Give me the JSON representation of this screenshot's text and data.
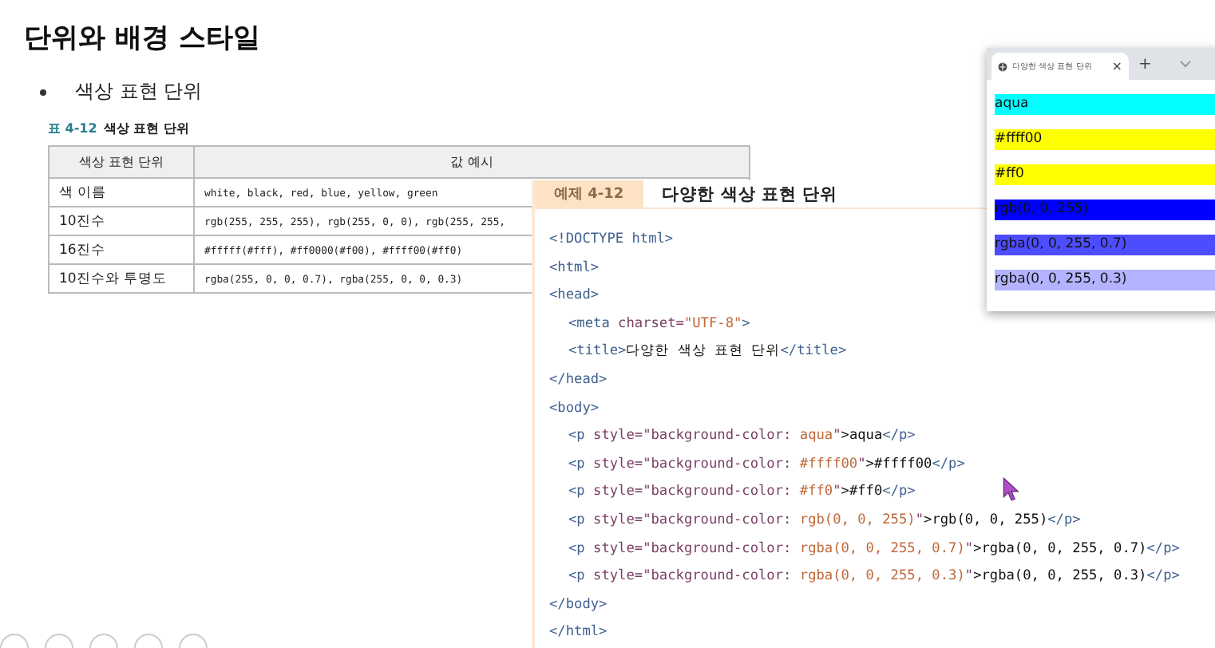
{
  "title": "단위와 배경 스타일",
  "bullet": "색상 표현 단위",
  "table": {
    "caption_label": "표 4-12",
    "caption_title": "색상 표현 단위",
    "columns": [
      "색상 표현 단위",
      "값 예시"
    ],
    "rows": [
      [
        "색 이름",
        "white, black, red, blue, yellow, green"
      ],
      [
        "10진수",
        "rgb(255, 255, 255), rgb(255, 0, 0), rgb(255, 255,"
      ],
      [
        "16진수",
        "#fffff(#fff), #ff0000(#f00), #ffff00(#ff0)"
      ],
      [
        "10진수와 투명도",
        "rgba(255, 0, 0, 0.7), rgba(255, 0, 0, 0.3)"
      ]
    ]
  },
  "example": {
    "tab": "예제 4-12",
    "title": "다양한 색상 표현 단위",
    "lines": [
      {
        "tokens": [
          {
            "kind": "tag",
            "text": "<!DOCTYPE html>"
          }
        ]
      },
      {
        "tokens": [
          {
            "kind": "tag",
            "text": "<html>"
          }
        ]
      },
      {
        "tokens": [
          {
            "kind": "tag",
            "text": "<head>"
          }
        ],
        "children": [
          {
            "tokens": [
              {
                "kind": "tag",
                "text": "<meta"
              },
              {
                "kind": "attr",
                "text": " charset="
              },
              {
                "kind": "value",
                "text": "\"UTF-8\""
              },
              {
                "kind": "tag",
                "text": ">"
              }
            ]
          },
          {
            "tokens": [
              {
                "kind": "tag",
                "text": "<title>"
              },
              {
                "kind": "text",
                "text": "다양한 색상 표현 단위"
              },
              {
                "kind": "tag",
                "text": "</title>"
              }
            ]
          }
        ]
      },
      {
        "tokens": [
          {
            "kind": "tag",
            "text": "</head>"
          }
        ]
      },
      {
        "tokens": [
          {
            "kind": "tag",
            "text": "<body>"
          }
        ],
        "children": [
          {
            "tokens": [
              {
                "kind": "tag",
                "text": "<p"
              },
              {
                "kind": "attr",
                "text": " style=\"background-color: "
              },
              {
                "kind": "value",
                "text": "aqua"
              },
              {
                "kind": "attr",
                "text": "\""
              },
              {
                "kind": "text",
                "text": ">aqua"
              },
              {
                "kind": "tag",
                "text": "</p>"
              }
            ]
          },
          {
            "tokens": [
              {
                "kind": "tag",
                "text": "<p"
              },
              {
                "kind": "attr",
                "text": " style=\"background-color: "
              },
              {
                "kind": "value",
                "text": "#ffff00"
              },
              {
                "kind": "attr",
                "text": "\""
              },
              {
                "kind": "text",
                "text": ">#ffff00"
              },
              {
                "kind": "tag",
                "text": "</p>"
              }
            ]
          },
          {
            "tokens": [
              {
                "kind": "tag",
                "text": "<p"
              },
              {
                "kind": "attr",
                "text": " style=\"background-color: "
              },
              {
                "kind": "value",
                "text": "#ff0"
              },
              {
                "kind": "attr",
                "text": "\""
              },
              {
                "kind": "text",
                "text": ">#ff0"
              },
              {
                "kind": "tag",
                "text": "</p>"
              }
            ]
          },
          {
            "tokens": [
              {
                "kind": "tag",
                "text": "<p"
              },
              {
                "kind": "attr",
                "text": " style=\"background-color: "
              },
              {
                "kind": "value",
                "text": "rgb(0, 0, 255)"
              },
              {
                "kind": "attr",
                "text": "\""
              },
              {
                "kind": "text",
                "text": ">rgb(0, 0, 255)"
              },
              {
                "kind": "tag",
                "text": "</p>"
              }
            ]
          },
          {
            "tokens": [
              {
                "kind": "tag",
                "text": "<p"
              },
              {
                "kind": "attr",
                "text": " style=\"background-color: "
              },
              {
                "kind": "value",
                "text": "rgba(0, 0, 255, 0.7)"
              },
              {
                "kind": "attr",
                "text": "\""
              },
              {
                "kind": "text",
                "text": ">rgba(0, 0, 255, 0.7)"
              },
              {
                "kind": "tag",
                "text": "</p>"
              }
            ]
          },
          {
            "tokens": [
              {
                "kind": "tag",
                "text": "<p"
              },
              {
                "kind": "attr",
                "text": " style=\"background-color: "
              },
              {
                "kind": "value",
                "text": "rgba(0, 0, 255, 0.3)"
              },
              {
                "kind": "attr",
                "text": "\""
              },
              {
                "kind": "text",
                "text": ">rgba(0, 0, 255, 0.3)"
              },
              {
                "kind": "tag",
                "text": "</p>"
              }
            ]
          }
        ]
      },
      {
        "tokens": [
          {
            "kind": "tag",
            "text": "</body>"
          }
        ]
      },
      {
        "tokens": [
          {
            "kind": "tag",
            "text": "</html>"
          }
        ]
      }
    ]
  },
  "browser": {
    "tab_title": "다양한 색상 표현 단위",
    "close": "×",
    "new_tab": "+",
    "paragraphs": [
      {
        "text": "aqua",
        "color": "#00ffff"
      },
      {
        "text": "#ffff00",
        "color": "#ffff00"
      },
      {
        "text": "#ff0",
        "color": "#ffff00"
      },
      {
        "text": "rgb(0, 0, 255)",
        "color": "#0000ff"
      },
      {
        "text": "rgba(0, 0, 255, 0.7)",
        "color": "#4d4dff"
      },
      {
        "text": "rgba(0, 0, 255, 0.3)",
        "color": "#b3b3ff"
      }
    ]
  }
}
